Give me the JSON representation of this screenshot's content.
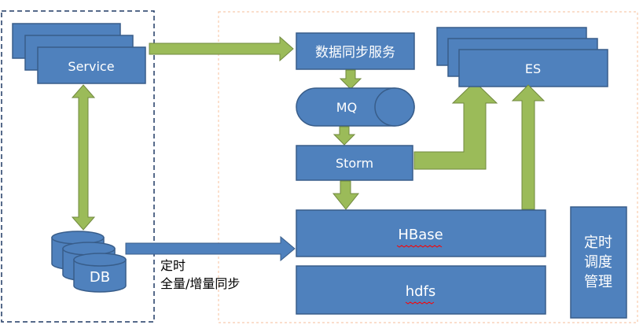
{
  "colors": {
    "box_fill": "#4F81BD",
    "box_stroke": "#385D8A",
    "arrow_fill": "#9BBB59",
    "arrow_stroke": "#71893F",
    "arrow_blue": "#4F81BD",
    "region_left_border": "#1F3864",
    "region_right_border": "#F8CBAD",
    "spellcheck_underline": "#FF0000"
  },
  "nodes": {
    "service": "Service",
    "sync_service": "数据同步服务",
    "mq": "MQ",
    "storm": "Storm",
    "es": "ES",
    "hbase": "HBase",
    "hdfs": "hdfs",
    "db": "DB",
    "scheduler_line1": "定时",
    "scheduler_line2": "调度",
    "scheduler_line3": "管理"
  },
  "edge_labels": {
    "db_to_hbase_line1": "定时",
    "db_to_hbase_line2": "全量/增量同步"
  }
}
